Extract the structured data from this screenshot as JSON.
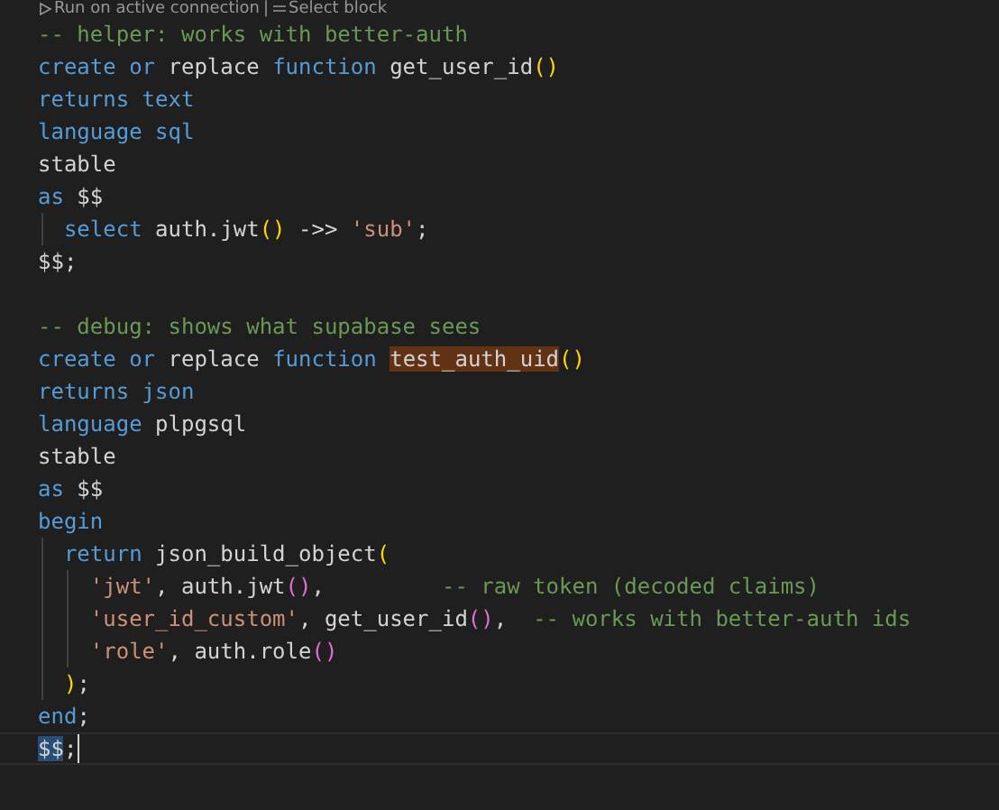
{
  "codelens": {
    "run": "Run on active connection",
    "separator": "|",
    "select": "Select block"
  },
  "lines": [
    {
      "current": false,
      "tokens": [
        {
          "kind": "comment",
          "text": "-- helper: works with better-auth"
        }
      ]
    },
    {
      "current": false,
      "tokens": [
        {
          "kind": "keyword",
          "text": "create or"
        },
        {
          "kind": "plain",
          "text": " replace "
        },
        {
          "kind": "keyword",
          "text": "function"
        },
        {
          "kind": "plain",
          "text": " get_user_id"
        },
        {
          "kind": "paren1",
          "text": "()"
        }
      ]
    },
    {
      "current": false,
      "tokens": [
        {
          "kind": "keyword",
          "text": "returns text"
        }
      ]
    },
    {
      "current": false,
      "tokens": [
        {
          "kind": "keyword",
          "text": "language sql"
        }
      ]
    },
    {
      "current": false,
      "tokens": [
        {
          "kind": "plain",
          "text": "stable"
        }
      ]
    },
    {
      "current": false,
      "tokens": [
        {
          "kind": "keyword",
          "text": "as"
        },
        {
          "kind": "plain",
          "text": " $$"
        }
      ]
    },
    {
      "current": false,
      "tokens": [
        {
          "kind": "keyword",
          "text": "  select"
        },
        {
          "kind": "plain",
          "text": " auth.jwt"
        },
        {
          "kind": "paren1",
          "text": "()"
        },
        {
          "kind": "plain",
          "text": " ->> "
        },
        {
          "kind": "string",
          "text": "'sub'"
        },
        {
          "kind": "plain",
          "text": ";"
        }
      ]
    },
    {
      "current": false,
      "tokens": [
        {
          "kind": "plain",
          "text": "$$;"
        }
      ]
    },
    {
      "current": false
    },
    {
      "current": false,
      "tokens": [
        {
          "kind": "comment",
          "text": "-- debug: shows what supabase sees"
        }
      ]
    },
    {
      "current": false,
      "tokens": [
        {
          "kind": "keyword",
          "text": "create or"
        },
        {
          "kind": "plain",
          "text": " replace "
        },
        {
          "kind": "keyword",
          "text": "function "
        },
        {
          "kind": "plain",
          "text": "test_auth_uid",
          "highlighted": true
        },
        {
          "kind": "paren1",
          "text": "()"
        }
      ]
    },
    {
      "current": false,
      "tokens": [
        {
          "kind": "keyword",
          "text": "returns json"
        }
      ]
    },
    {
      "current": false,
      "tokens": [
        {
          "kind": "keyword",
          "text": "language"
        },
        {
          "kind": "plain",
          "text": " plpgsql"
        }
      ]
    },
    {
      "current": false,
      "tokens": [
        {
          "kind": "plain",
          "text": "stable"
        }
      ]
    },
    {
      "current": false,
      "tokens": [
        {
          "kind": "keyword",
          "text": "as"
        },
        {
          "kind": "plain",
          "text": " $$"
        }
      ]
    },
    {
      "current": false,
      "tokens": [
        {
          "kind": "keyword",
          "text": "begin"
        }
      ]
    },
    {
      "current": false,
      "tokens": [
        {
          "kind": "keyword",
          "text": "  return"
        },
        {
          "kind": "plain",
          "text": " json_build_object"
        },
        {
          "kind": "paren1",
          "text": "("
        }
      ]
    },
    {
      "current": false,
      "tokens": [
        {
          "kind": "string",
          "text": "    'jwt'"
        },
        {
          "kind": "plain",
          "text": ", auth.jwt"
        },
        {
          "kind": "paren2",
          "text": "()"
        },
        {
          "kind": "plain",
          "text": ",         "
        },
        {
          "kind": "comment",
          "text": "-- raw token (decoded claims)"
        }
      ]
    },
    {
      "current": false,
      "tokens": [
        {
          "kind": "string",
          "text": "    'user_id_custom'"
        },
        {
          "kind": "plain",
          "text": ", get_user_id"
        },
        {
          "kind": "paren2",
          "text": "()"
        },
        {
          "kind": "plain",
          "text": ",  "
        },
        {
          "kind": "comment",
          "text": "-- works with better-auth ids"
        }
      ]
    },
    {
      "current": false,
      "tokens": [
        {
          "kind": "string",
          "text": "    'role'"
        },
        {
          "kind": "plain",
          "text": ", auth.role"
        },
        {
          "kind": "paren2",
          "text": "()"
        }
      ]
    },
    {
      "current": false,
      "tokens": [
        {
          "kind": "paren1",
          "text": "  )"
        },
        {
          "kind": "plain",
          "text": ";"
        }
      ]
    },
    {
      "current": false,
      "tokens": [
        {
          "kind": "keyword",
          "text": "end"
        },
        {
          "kind": "plain",
          "text": ";"
        }
      ]
    },
    {
      "current": true,
      "tokens": [
        {
          "kind": "plain",
          "text": "$$",
          "selected": true
        },
        {
          "kind": "plain",
          "text": ";"
        }
      ]
    }
  ]
}
